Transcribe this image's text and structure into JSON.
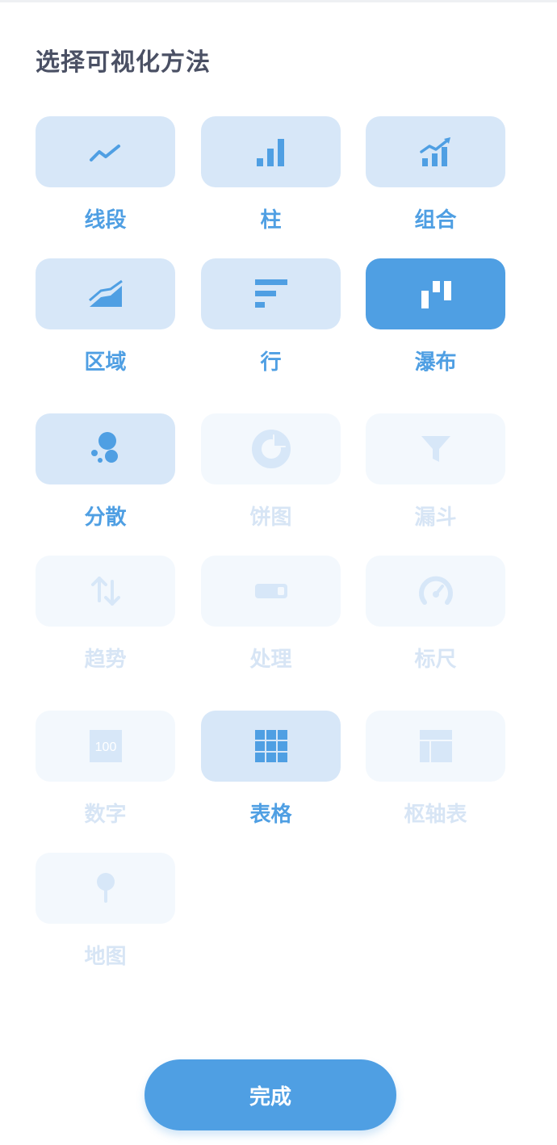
{
  "title": "选择可视化方法",
  "colors": {
    "accent": "#4f9fe3",
    "tile_enabled_bg": "#d7e7f8",
    "tile_disabled_bg": "#f3f8fd",
    "label_disabled": "#d7e5f5",
    "title_text": "#4a5064"
  },
  "options": [
    {
      "label": "线段",
      "icon": "line-chart-icon",
      "state": "enabled"
    },
    {
      "label": "柱",
      "icon": "bar-chart-icon",
      "state": "enabled"
    },
    {
      "label": "组合",
      "icon": "combo-chart-icon",
      "state": "enabled"
    },
    {
      "label": "区域",
      "icon": "area-chart-icon",
      "state": "enabled"
    },
    {
      "label": "行",
      "icon": "row-chart-icon",
      "state": "enabled"
    },
    {
      "label": "瀑布",
      "icon": "waterfall-chart-icon",
      "state": "selected"
    },
    {
      "label": "分散",
      "icon": "scatter-chart-icon",
      "state": "enabled"
    },
    {
      "label": "饼图",
      "icon": "pie-chart-icon",
      "state": "disabled"
    },
    {
      "label": "漏斗",
      "icon": "funnel-icon",
      "state": "disabled"
    },
    {
      "label": "趋势",
      "icon": "trend-arrows-icon",
      "state": "disabled"
    },
    {
      "label": "处理",
      "icon": "progress-bar-icon",
      "state": "disabled"
    },
    {
      "label": "标尺",
      "icon": "gauge-icon",
      "state": "disabled"
    },
    {
      "label": "数字",
      "icon": "number-icon",
      "icon_text": "100",
      "state": "disabled"
    },
    {
      "label": "表格",
      "icon": "table-icon",
      "state": "enabled"
    },
    {
      "label": "枢轴表",
      "icon": "pivot-table-icon",
      "state": "disabled"
    },
    {
      "label": "地图",
      "icon": "map-pin-icon",
      "state": "disabled"
    }
  ],
  "done_button": {
    "label": "完成"
  }
}
